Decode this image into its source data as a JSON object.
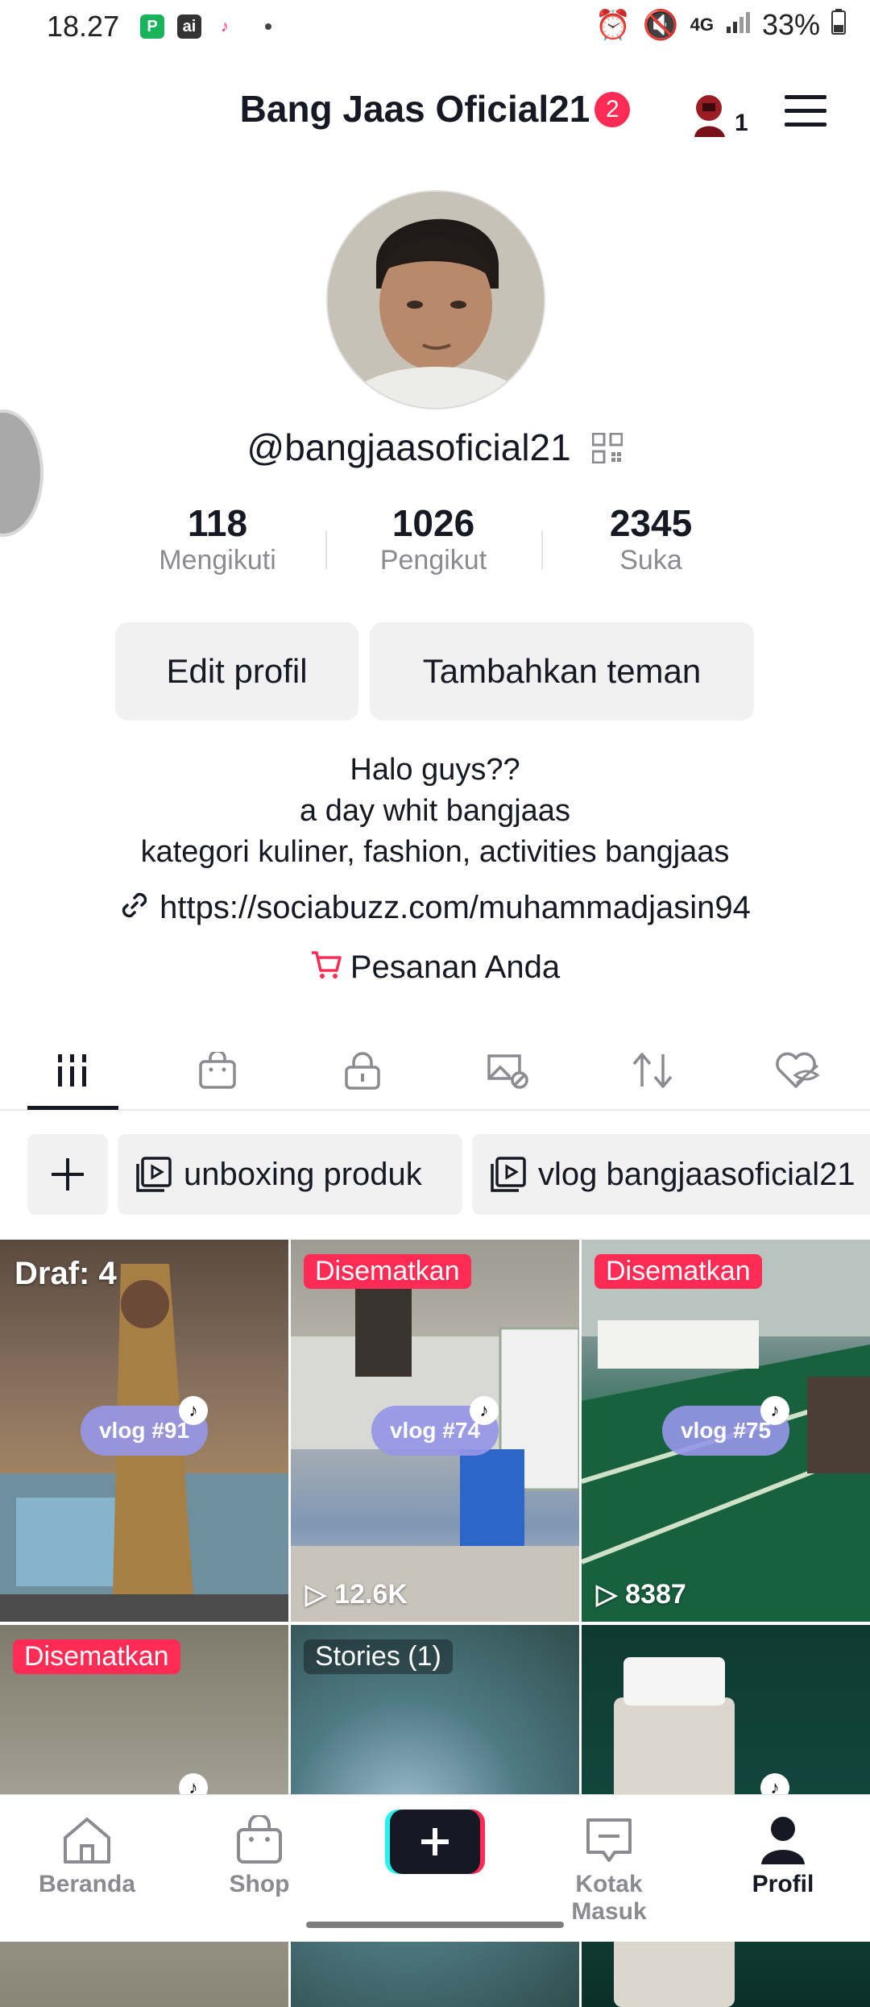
{
  "status_bar": {
    "time": "18.27",
    "network": "4G",
    "battery": "33%"
  },
  "header": {
    "title": "Bang Jaas Oficial21",
    "notification_count": "2",
    "friends_count": "1"
  },
  "profile": {
    "handle": "@bangjaasoficial21",
    "stats": [
      {
        "value": "118",
        "label": "Mengikuti"
      },
      {
        "value": "1026",
        "label": "Pengikut"
      },
      {
        "value": "2345",
        "label": "Suka"
      }
    ],
    "edit_button": "Edit profil",
    "add_friends_button": "Tambahkan teman",
    "bio": [
      "Halo guys??",
      "a day whit bangjaas",
      "kategori kuliner, fashion, activities bangjaas"
    ],
    "link": "https://sociabuzz.com/muhammadjasin94",
    "orders": "Pesanan Anda"
  },
  "tabs": [
    {
      "icon": "grid-icon",
      "active": true
    },
    {
      "icon": "shop-bag-icon"
    },
    {
      "icon": "lock-icon"
    },
    {
      "icon": "tagged-icon"
    },
    {
      "icon": "repost-icon"
    },
    {
      "icon": "liked-hidden-icon"
    }
  ],
  "playlists": [
    {
      "label": "unboxing produk"
    },
    {
      "label": "vlog bangjaasoficial21"
    }
  ],
  "videos": [
    {
      "badge": "Draf: 4",
      "tag": "vlog #91",
      "views": ""
    },
    {
      "badge": "Disematkan",
      "tag": "vlog #74",
      "views": "12.6K"
    },
    {
      "badge": "Disematkan",
      "tag": "vlog #75",
      "views": "8387"
    },
    {
      "badge": "Disematkan",
      "tag": "",
      "views": ""
    },
    {
      "badge": "Stories (1)",
      "tag": "",
      "views": ""
    },
    {
      "badge": "",
      "tag": "",
      "views": ""
    }
  ],
  "bottom_nav": [
    {
      "label": "Beranda"
    },
    {
      "label": "Shop"
    },
    {
      "label": ""
    },
    {
      "label": "Kotak Masuk"
    },
    {
      "label": "Profil",
      "active": true
    }
  ],
  "colors": {
    "accent": "#fe2c55",
    "text": "#161823",
    "muted": "#8a8b91",
    "chip_bg": "#f1f1f2"
  }
}
